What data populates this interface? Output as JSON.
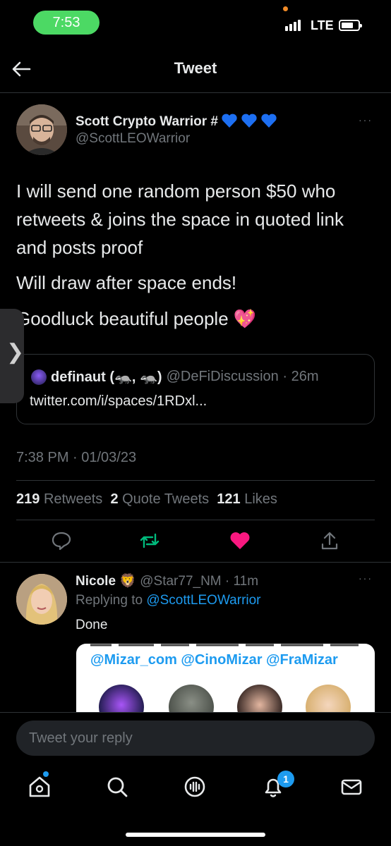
{
  "status_bar": {
    "time": "7:53",
    "network": "LTE"
  },
  "header": {
    "title": "Tweet"
  },
  "tweet": {
    "author_name": "Scott Crypto Warrior #",
    "author_handle": "@ScottLEOWarrior",
    "more": "···",
    "paragraphs": [
      "I will send one random person $50 who retweets & joins the space in quoted link and posts proof",
      "Will draw after space ends!",
      "Goodluck beautiful people 💖"
    ],
    "quote": {
      "name": "definaut (🦡, 🦡)",
      "handle_time": "@DeFiDiscussion · 26m",
      "link": "twitter.com/i/spaces/1RDxl..."
    },
    "timestamp": "7:38 PM · 01/03/23",
    "stats": {
      "retweets_count": "219",
      "retweets_label": "Retweets",
      "quotes_count": "2",
      "quotes_label": "Quote Tweets",
      "likes_count": "121",
      "likes_label": "Likes"
    }
  },
  "reply": {
    "name": "Nicole 🦁",
    "handle_time": "@Star77_NM · 11m",
    "replying_prefix": "Replying to",
    "replying_to": "@ScottLEOWarrior",
    "text": "Done",
    "image_mentions": "@Mizar_com @CinoMizar @FraMizar",
    "more": "···"
  },
  "compose": {
    "placeholder": "Tweet your reply"
  },
  "nav": {
    "notifications_badge": "1"
  },
  "colors": {
    "accent": "#1d9bf0",
    "like": "#f91880",
    "retweet": "#00ba7c",
    "background": "#000000"
  }
}
